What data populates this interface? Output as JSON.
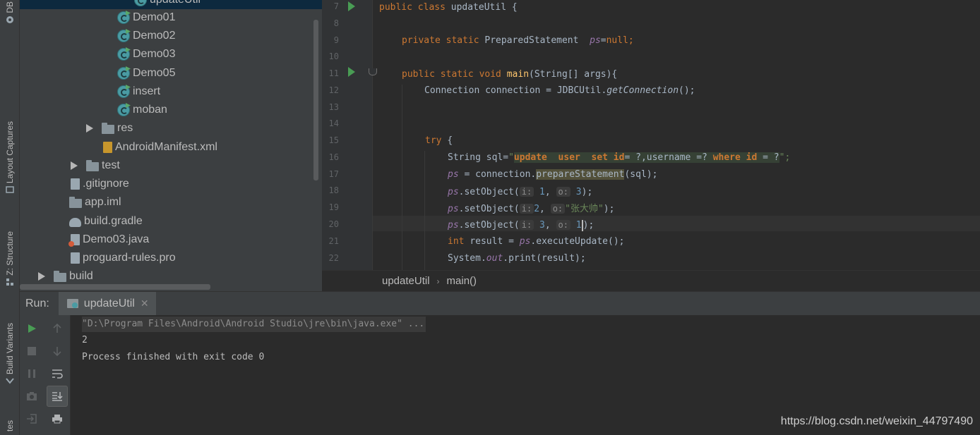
{
  "left_strip": {
    "db_label": "DB",
    "layout_captures_label": "Layout Captures",
    "structure_label": "Z: Structure",
    "build_variants_label": "Build Variants",
    "favorites_label": "tes"
  },
  "project_tree": {
    "items": [
      {
        "label": "updateUtil",
        "type": "class",
        "selected": true
      },
      {
        "label": "Demo01",
        "type": "class"
      },
      {
        "label": "Demo02",
        "type": "class"
      },
      {
        "label": "Demo03",
        "type": "class"
      },
      {
        "label": "Demo05",
        "type": "class"
      },
      {
        "label": "insert",
        "type": "class"
      },
      {
        "label": "moban",
        "type": "class"
      },
      {
        "label": "res",
        "type": "folder"
      },
      {
        "label": "AndroidManifest.xml",
        "type": "xml"
      },
      {
        "label": "test",
        "type": "folder"
      },
      {
        "label": ".gitignore",
        "type": "file"
      },
      {
        "label": "app.iml",
        "type": "file"
      },
      {
        "label": "build.gradle",
        "type": "gradle"
      },
      {
        "label": "Demo03.java",
        "type": "java"
      },
      {
        "label": "proguard-rules.pro",
        "type": "file"
      },
      {
        "label": "build",
        "type": "folder"
      }
    ]
  },
  "editor": {
    "line_numbers": [
      "7",
      "8",
      "9",
      "10",
      "11",
      "12",
      "13",
      "14",
      "15",
      "16",
      "17",
      "18",
      "19",
      "20",
      "21",
      "22"
    ],
    "code": {
      "l7_kw": "public class ",
      "l7_rest": "updateUtil {",
      "l9_kw": "private static ",
      "l9_type": "PreparedStatement  ",
      "l9_var": "ps",
      "l9_eq": "=",
      "l9_null": "null;",
      "l11_kw": "public static void ",
      "l11_fn": "main",
      "l11_rest": "(String[] args){",
      "l12_a": "Connection connection = JDBCUtil.",
      "l12_b": "getConnection",
      "l12_c": "();",
      "l15_kw": "try ",
      "l15_rest": "{",
      "l16_a": "String sql=",
      "l16_q1": "\"",
      "l16_update": "update  user  set id",
      "l16_mid": "= ?,username =? ",
      "l16_where": "where id",
      "l16_end": " = ?",
      "l16_q2": "\";",
      "l17_ps": "ps",
      "l17_mid": " = connection.",
      "l17_call": "prepareStatement",
      "l17_end": "(sql);",
      "l18_ps": "ps",
      "l18_call": ".setObject(",
      "l18_h1": "i:",
      "l18_v1": "1",
      "l18_h2": "o:",
      "l18_v2": "3",
      "l18_end": ");",
      "l19_ps": "ps",
      "l19_call": ".setObject(",
      "l19_h1": "i:",
      "l19_v1": "2",
      "l19_h2": "o:",
      "l19_v2": "\"张大帅\"",
      "l19_end": ");",
      "l20_ps": "ps",
      "l20_call": ".setObject(",
      "l20_h1": "i:",
      "l20_v1": "3",
      "l20_h2": "o:",
      "l20_v2": "1",
      "l20_end": ");",
      "l21_kw": "int ",
      "l21_a": "result = ",
      "l21_ps": "ps",
      "l21_b": ".executeUpdate();",
      "l22_a": "System.",
      "l22_out": "out",
      "l22_b": ".print(result);"
    }
  },
  "breadcrumb": {
    "class": "updateUtil",
    "method": "main()"
  },
  "run_panel": {
    "label": "Run:",
    "tab_label": "updateUtil",
    "console": [
      "\"D:\\Program Files\\Android\\Android Studio\\jre\\bin\\java.exe\" ...",
      "2",
      "Process finished with exit code 0"
    ]
  },
  "watermark": "https://blog.csdn.net/weixin_44797490"
}
